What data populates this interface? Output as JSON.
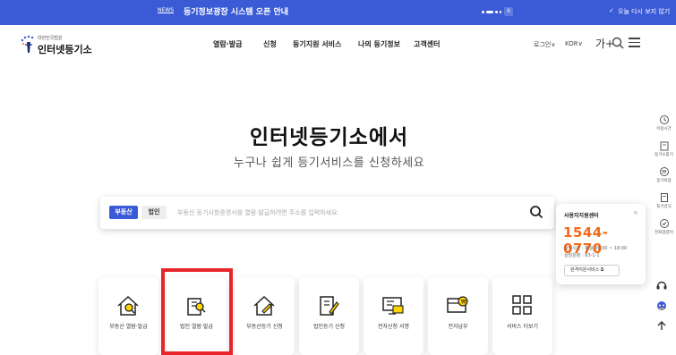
{
  "notice": {
    "tag": "NEWS",
    "message": "등기정보광장 시스템 오픈 안내",
    "pause_label": "II",
    "dismiss_label": "오늘 다시 보지 않기"
  },
  "header": {
    "logo_sub": "대한민국법원",
    "logo_name": "인터넷등기소",
    "nav": [
      "열람·발급",
      "신청",
      "등기지원 서비스",
      "나의 등기정보",
      "고객센터"
    ],
    "login_label": "로그인∨",
    "lang_label": "KOR∨",
    "font_label": "가+"
  },
  "hero": {
    "title": "인터넷등기소에서",
    "subtitle": "누구나 쉽게 등기서비스를 신청하세요"
  },
  "search": {
    "tabs": [
      "부동산",
      "법인"
    ],
    "placeholder": "부동산 등기사항증명서를 열람·발급하려면 주소를 입력하세요."
  },
  "cards": [
    {
      "label": "부동산 열람·발급",
      "icon": "house-search-icon"
    },
    {
      "label": "법인 열람·발급",
      "icon": "building-search-icon"
    },
    {
      "label": "부동산등기 신청",
      "icon": "house-edit-icon"
    },
    {
      "label": "법인등기 신청",
      "icon": "building-edit-icon"
    },
    {
      "label": "전자신청 서명",
      "icon": "e-sign-icon"
    },
    {
      "label": "전자납부",
      "icon": "e-payment-icon"
    },
    {
      "label": "서비스 더보기",
      "icon": "grid-more-icon"
    }
  ],
  "callcenter": {
    "title": "사용자지원센터",
    "close": "×",
    "phone": "1544-0770",
    "hours": "상담시간 : 평일 09:00 ~ 18:00",
    "remote": "상담원정 : 83-1-1",
    "button": "원격지원서비스 ⧉"
  },
  "quick_menu": [
    "이용시간",
    "등기소찾기",
    "등기비용",
    "등기양식",
    "전화걸렸어"
  ],
  "colors": {
    "primary": "#3b5bd6",
    "accent_orange": "#f06a1a",
    "highlight": "#e8252a"
  }
}
